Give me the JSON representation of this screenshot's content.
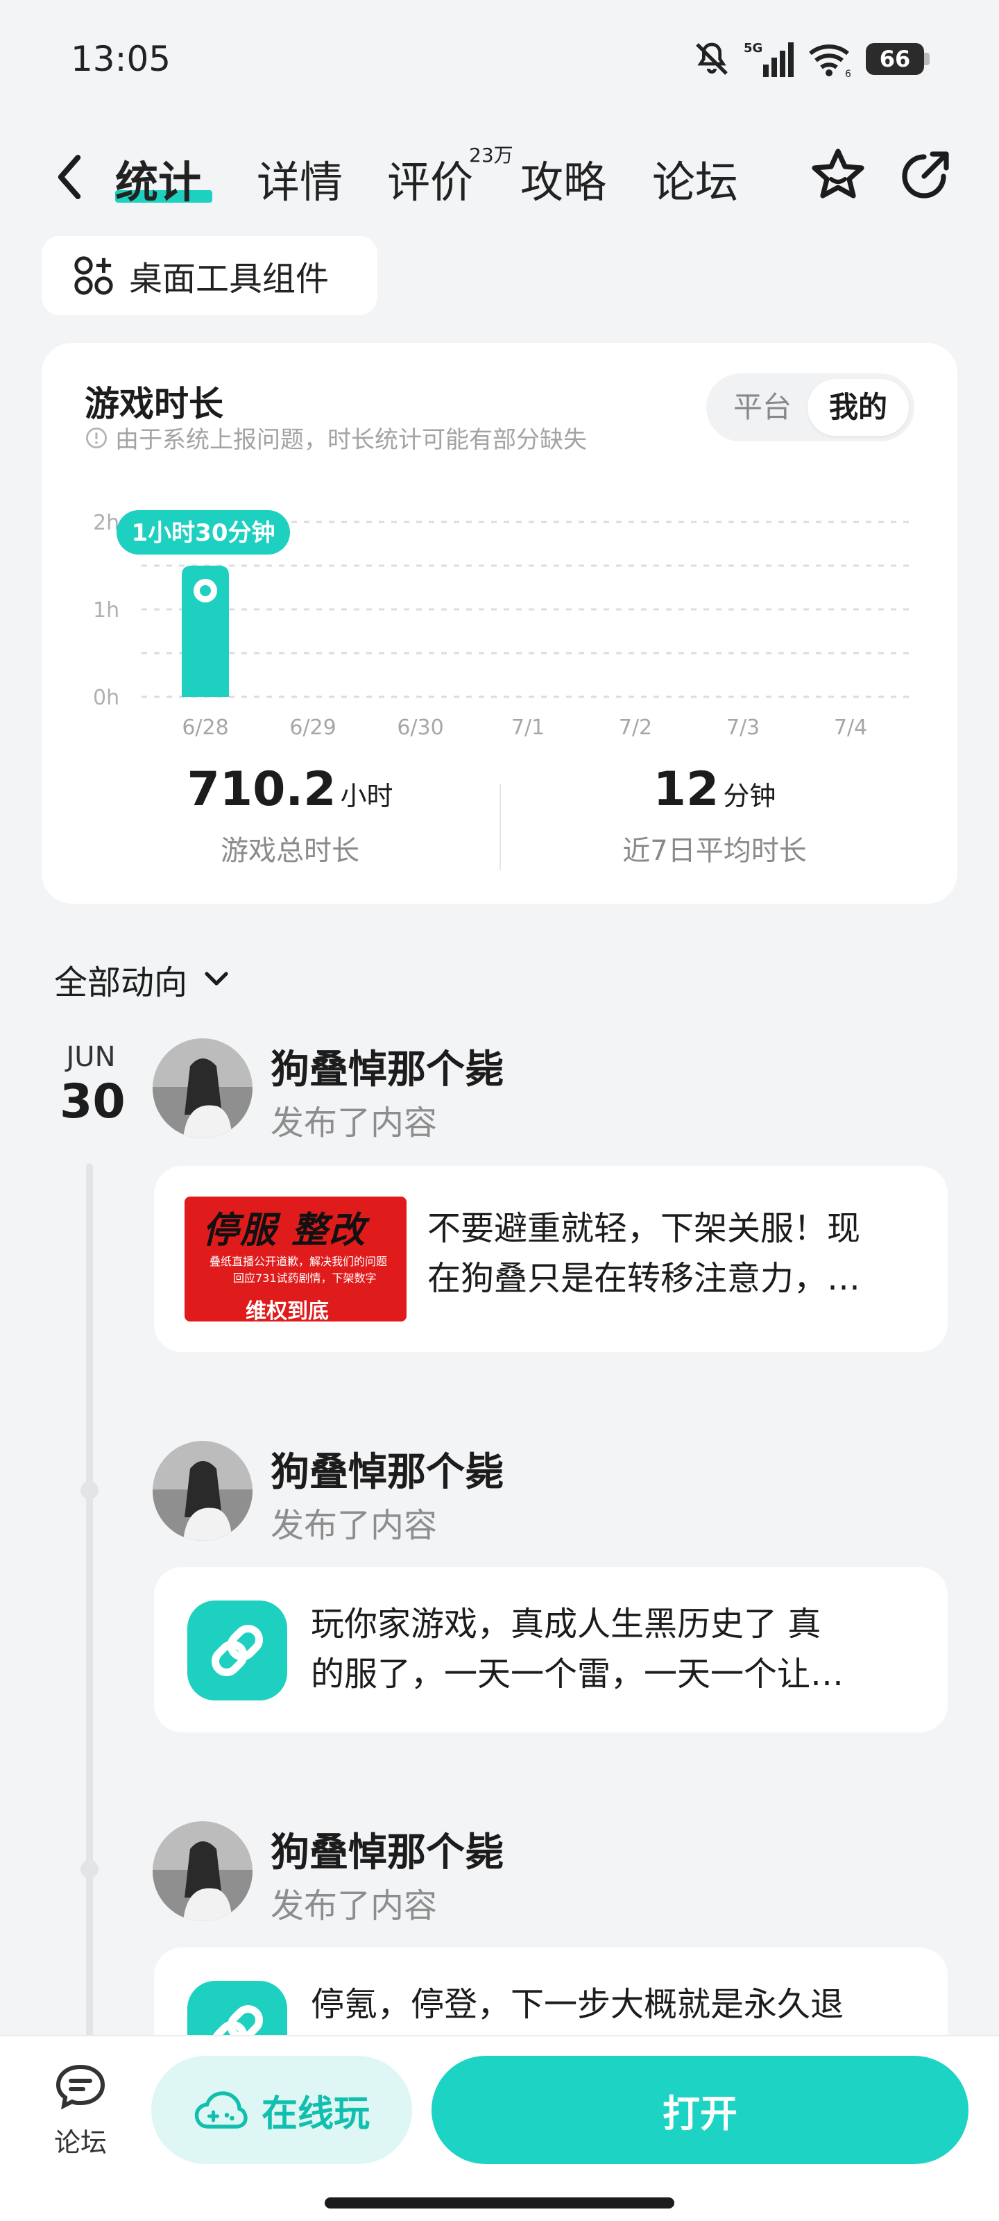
{
  "status": {
    "time": "13:05",
    "network": "5G",
    "wifi_badge": "6",
    "battery": "66",
    "icons": [
      "mute-bell-icon",
      "signal-icon",
      "wifi-icon",
      "battery-icon"
    ]
  },
  "nav": {
    "back_icon": "chevron-left-icon",
    "tabs": [
      {
        "label": "统计",
        "active": true
      },
      {
        "label": "详情"
      },
      {
        "label": "评价",
        "badge": "23万"
      },
      {
        "label": "攻略"
      },
      {
        "label": "论坛"
      }
    ],
    "actions": [
      "star-icon",
      "share-icon"
    ]
  },
  "widget_chip": {
    "label": "桌面工具组件",
    "icon": "widget-grid-icon"
  },
  "stats": {
    "title": "游戏时长",
    "note": "由于系统上报问题，时长统计可能有部分缺失",
    "toggle": {
      "options": [
        "平台",
        "我的"
      ],
      "selected": "我的"
    },
    "tooltip": "1小时30分钟",
    "total": {
      "value": "710.2",
      "unit": "小时",
      "label": "游戏总时长"
    },
    "avg": {
      "value": "12",
      "unit": "分钟",
      "label": "近7日平均时长"
    }
  },
  "chart_data": {
    "type": "bar",
    "categories": [
      "6/28",
      "6/29",
      "6/30",
      "7/1",
      "7/2",
      "7/3",
      "7/4"
    ],
    "values": [
      1.5,
      0,
      0,
      0,
      0,
      0,
      0
    ],
    "y_ticks": [
      "0h",
      "1h",
      "2h"
    ],
    "ylim": [
      0,
      2
    ],
    "grid": true,
    "bar_color": "#1dd0c0"
  },
  "feed": {
    "filter_label": "全部动向",
    "date": {
      "month": "JUN",
      "day": "30"
    },
    "posts": [
      {
        "author": "狗叠悼那个毙",
        "action": "发布了内容",
        "line1": "不要避重就轻，下架关服！现",
        "line2": "在狗叠只是在转移注意力，…",
        "thumb": {
          "line1": "停服   整改",
          "line2": "叠纸直播公开道歉，解决我们的问题",
          "line3": "回应731试药剧情，下架数字",
          "line4": "维权到底"
        }
      },
      {
        "author": "狗叠悼那个毙",
        "action": "发布了内容",
        "line1": "玩你家游戏，真成人生黑历史了 真",
        "line2": "的服了，一天一个雷，一天一个让…"
      },
      {
        "author": "狗叠悼那个毙",
        "action": "发布了内容",
        "line1": "停氪，停登，下一步大概就是永久退"
      }
    ]
  },
  "bottom": {
    "forum_label": "论坛",
    "online_label": "在线玩",
    "open_label": "打开"
  },
  "colors": {
    "accent": "#1dd0c0",
    "background": "#f3f4f6"
  }
}
